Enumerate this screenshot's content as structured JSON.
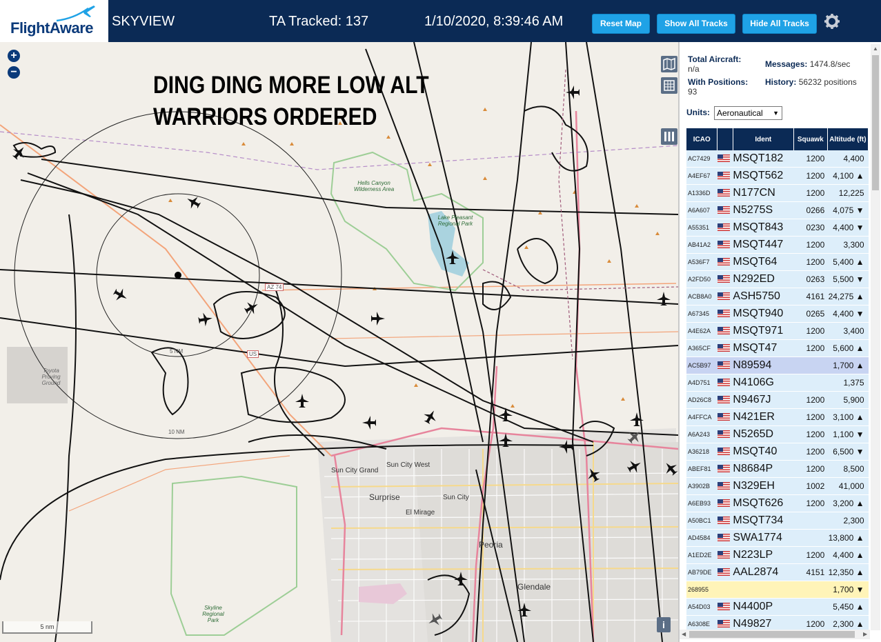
{
  "header": {
    "logo_text": "FlightAware",
    "app_name": "SKYVIEW",
    "tracked": "TA Tracked: 137",
    "datetime": "1/10/2020, 8:39:46 AM",
    "buttons": {
      "reset": "Reset Map",
      "show": "Show All Tracks",
      "hide": "Hide All Tracks"
    },
    "colors": {
      "bar": "#0b2a55",
      "button": "#1fa2e6"
    }
  },
  "map": {
    "banner_line1": "DING DING MORE LOW ALT",
    "banner_line2": "WARRIORS ORDERED",
    "zoom_in": "+",
    "zoom_out": "−",
    "scale": "5 nm",
    "info": "i",
    "range_rings": {
      "inner": "5 NM",
      "outer": "10 NM"
    },
    "labels": {
      "hells_canyon": "Hells Canyon Wilderness Area",
      "lake_pleasant": "Lake Pleasant Regional Park",
      "proving": "Toyota Proving Ground",
      "skyline": "Skyline Regional Park",
      "az74": "AZ 74",
      "us60": "US",
      "sun_city_grand": "Sun City Grand",
      "sun_city_west": "Sun City West",
      "surprise": "Surprise",
      "sun_city": "Sun City",
      "el_mirage": "El Mirage",
      "peoria": "Peoria",
      "glendale": "Glendale"
    }
  },
  "sidebar": {
    "total_aircraft_label": "Total Aircraft:",
    "total_aircraft_value": "n/a",
    "with_positions_label": "With Positions:",
    "with_positions_value": "93",
    "messages_label": "Messages:",
    "messages_value": "1474.8/sec",
    "history_label": "History:",
    "history_value": "56232 positions",
    "units_label": "Units:",
    "units_value": "Aeronautical",
    "columns": [
      "ICAO",
      "",
      "Ident",
      "Squawk",
      "Altitude (ft)"
    ],
    "rows": [
      {
        "icao": "AC7429",
        "ident": "MSQT182",
        "squawk": "1200",
        "alt": "4,400",
        "flag": true
      },
      {
        "icao": "A4EF67",
        "ident": "MSQT562",
        "squawk": "1200",
        "alt": "4,100 ▲",
        "flag": true
      },
      {
        "icao": "A1336D",
        "ident": "N177CN",
        "squawk": "1200",
        "alt": "12,225",
        "flag": true
      },
      {
        "icao": "A6A607",
        "ident": "N5275S",
        "squawk": "0266",
        "alt": "4,075 ▼",
        "flag": true
      },
      {
        "icao": "A55351",
        "ident": "MSQT843",
        "squawk": "0230",
        "alt": "4,400 ▼",
        "flag": true
      },
      {
        "icao": "AB41A2",
        "ident": "MSQT447",
        "squawk": "1200",
        "alt": "3,300",
        "flag": true
      },
      {
        "icao": "A536F7",
        "ident": "MSQT64",
        "squawk": "1200",
        "alt": "5,400 ▲",
        "flag": true
      },
      {
        "icao": "A2FD50",
        "ident": "N292ED",
        "squawk": "0263",
        "alt": "5,500 ▼",
        "flag": true
      },
      {
        "icao": "ACB8A0",
        "ident": "ASH5750",
        "squawk": "4161",
        "alt": "24,275 ▲",
        "flag": true
      },
      {
        "icao": "A67345",
        "ident": "MSQT940",
        "squawk": "0265",
        "alt": "4,400 ▼",
        "flag": true
      },
      {
        "icao": "A4E62A",
        "ident": "MSQT971",
        "squawk": "1200",
        "alt": "3,400",
        "flag": true
      },
      {
        "icao": "A365CF",
        "ident": "MSQT47",
        "squawk": "1200",
        "alt": "5,600 ▲",
        "flag": true
      },
      {
        "icao": "AC5B97",
        "ident": "N89594",
        "squawk": "",
        "alt": "1,700 ▲",
        "flag": true,
        "state": "sel"
      },
      {
        "icao": "A4D751",
        "ident": "N4106G",
        "squawk": "",
        "alt": "1,375",
        "flag": true
      },
      {
        "icao": "AD26C8",
        "ident": "N9467J",
        "squawk": "1200",
        "alt": "5,900",
        "flag": true
      },
      {
        "icao": "A4FFCA",
        "ident": "N421ER",
        "squawk": "1200",
        "alt": "3,100 ▲",
        "flag": true
      },
      {
        "icao": "A6A243",
        "ident": "N5265D",
        "squawk": "1200",
        "alt": "1,100 ▼",
        "flag": true
      },
      {
        "icao": "A36218",
        "ident": "MSQT40",
        "squawk": "1200",
        "alt": "6,500 ▼",
        "flag": true
      },
      {
        "icao": "ABEF81",
        "ident": "N8684P",
        "squawk": "1200",
        "alt": "8,500",
        "flag": true
      },
      {
        "icao": "A3902B",
        "ident": "N329EH",
        "squawk": "1002",
        "alt": "41,000",
        "flag": true
      },
      {
        "icao": "A6EB93",
        "ident": "MSQT626",
        "squawk": "1200",
        "alt": "3,200 ▲",
        "flag": true
      },
      {
        "icao": "A50BC1",
        "ident": "MSQT734",
        "squawk": "",
        "alt": "2,300",
        "flag": true
      },
      {
        "icao": "AD4584",
        "ident": "SWA1774",
        "squawk": "",
        "alt": "13,800 ▲",
        "flag": true
      },
      {
        "icao": "A1ED2E",
        "ident": "N223LP",
        "squawk": "1200",
        "alt": "4,400 ▲",
        "flag": true
      },
      {
        "icao": "AB79DE",
        "ident": "AAL2874",
        "squawk": "4151",
        "alt": "12,350 ▲",
        "flag": true
      },
      {
        "icao": "268955",
        "ident": "",
        "squawk": "",
        "alt": "1,700 ▼",
        "flag": false,
        "state": "yel"
      },
      {
        "icao": "A54D03",
        "ident": "N4400P",
        "squawk": "",
        "alt": "5,450 ▲",
        "flag": true
      },
      {
        "icao": "A6308E",
        "ident": "N49827",
        "squawk": "1200",
        "alt": "2,300 ▲",
        "flag": true
      }
    ]
  }
}
